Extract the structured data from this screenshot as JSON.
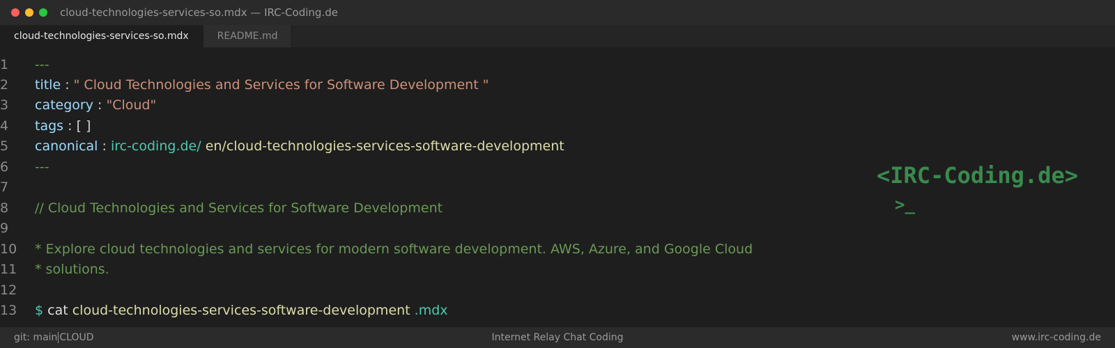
{
  "window": {
    "title": "cloud-technologies-services-so.mdx — IRC-Coding.de"
  },
  "tabs": [
    {
      "label": "cloud-technologies-services-so.mdx",
      "active": true
    },
    {
      "label": "README.md",
      "active": false
    }
  ],
  "editor": {
    "line_numbers": [
      "1",
      "2",
      "3",
      "4",
      "5",
      "6",
      "7",
      "8",
      "9",
      "10",
      "11",
      "12",
      "13"
    ],
    "frontmatter_delimiter": "---",
    "title_key": "title",
    "title_value": "\" Cloud Technologies and Services for Software Development \"",
    "category_key": "category",
    "category_value": "\"Cloud\"",
    "tags_key": "tags",
    "tags_value": "[ ]",
    "canonical_key": "canonical",
    "canonical_domain": "irc-coding.de/",
    "canonical_path": "en/cloud-technologies-services-software-development",
    "colon": ":",
    "comment_line": "// Cloud Technologies and Services for Software Development",
    "description_line_1": "* Explore cloud technologies and services for modern software development. AWS, Azure, and Google Cloud",
    "description_line_2": "* solutions.",
    "prompt_symbol": "$",
    "command": "cat",
    "command_arg": "cloud-technologies-services-software-development",
    "command_ext": ".mdx"
  },
  "logo": {
    "text": "<IRC-Coding.de>",
    "prompt": ">_"
  },
  "statusbar": {
    "branch": "git: main",
    "category": "CLOUD",
    "center": "Internet Relay Chat Coding",
    "right": "www.irc-coding.de"
  },
  "colors": {
    "background": "#1e1e1e",
    "key": "#9cdcfe",
    "string": "#ce9178",
    "comment": "#6a9955",
    "link": "#4ec9b0",
    "path": "#dcdcaa",
    "logo": "#3a8a4e"
  }
}
